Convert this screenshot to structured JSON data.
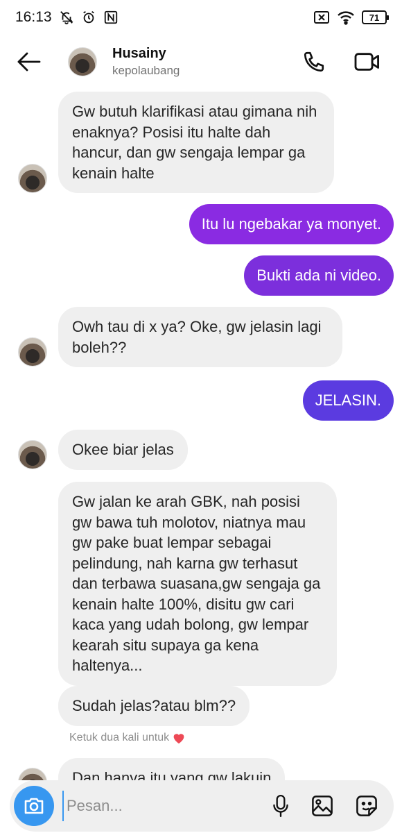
{
  "status_bar": {
    "time": "16:13",
    "battery": "71",
    "icons": [
      "notifications-off-icon",
      "alarm-icon",
      "nfc-icon",
      "sim-off-icon",
      "wifi-icon",
      "battery-icon"
    ]
  },
  "header": {
    "name": "Husainy",
    "username": "kepolaubang",
    "icons": [
      "back-arrow-icon",
      "phone-icon",
      "video-camera-icon"
    ]
  },
  "messages": [
    {
      "from": "them",
      "text": "Gw butuh klarifikasi atau gimana nih enaknya? Posisi itu halte dah hancur, dan gw sengaja lempar ga kenain halte",
      "avatar": true
    },
    {
      "from": "me",
      "text": "Itu lu ngebakar ya monyet.",
      "color": "#8a2be2"
    },
    {
      "from": "me",
      "text": "Bukti ada ni video.",
      "color": "#7c2fdc"
    },
    {
      "from": "them",
      "text": "Owh tau di x ya? Oke, gw jelasin lagi boleh??",
      "avatar": true
    },
    {
      "from": "me",
      "text": "JELASIN.",
      "color": "#5b3be0"
    },
    {
      "from": "them",
      "text": "Okee biar jelas",
      "avatar": true
    },
    {
      "from": "them",
      "text": "Gw jalan ke arah GBK, nah posisi gw bawa tuh molotov, niatnya mau gw pake buat lempar sebagai pelindung, nah karna gw terhasut dan terbawa suasana,gw sengaja ga kenain halte 100%, disitu gw cari kaca yang udah bolong, gw lempar kearah situ supaya ga kena haltenya...",
      "avatar": false
    },
    {
      "from": "them",
      "text": "Sudah jelas?atau blm??",
      "avatar": false
    },
    {
      "from": "them",
      "text": "Dan hanya itu yang gw lakuin",
      "avatar": true
    }
  ],
  "hint": {
    "text": "Ketuk dua kali untuk",
    "icon": "heart-icon"
  },
  "composer": {
    "placeholder": "Pesan...",
    "icons": [
      "camera-icon",
      "microphone-icon",
      "gallery-icon",
      "sticker-icon"
    ]
  },
  "colors": {
    "accent": "#3797f0",
    "incoming_bubble": "#efefef",
    "heart": "#ed4956"
  }
}
